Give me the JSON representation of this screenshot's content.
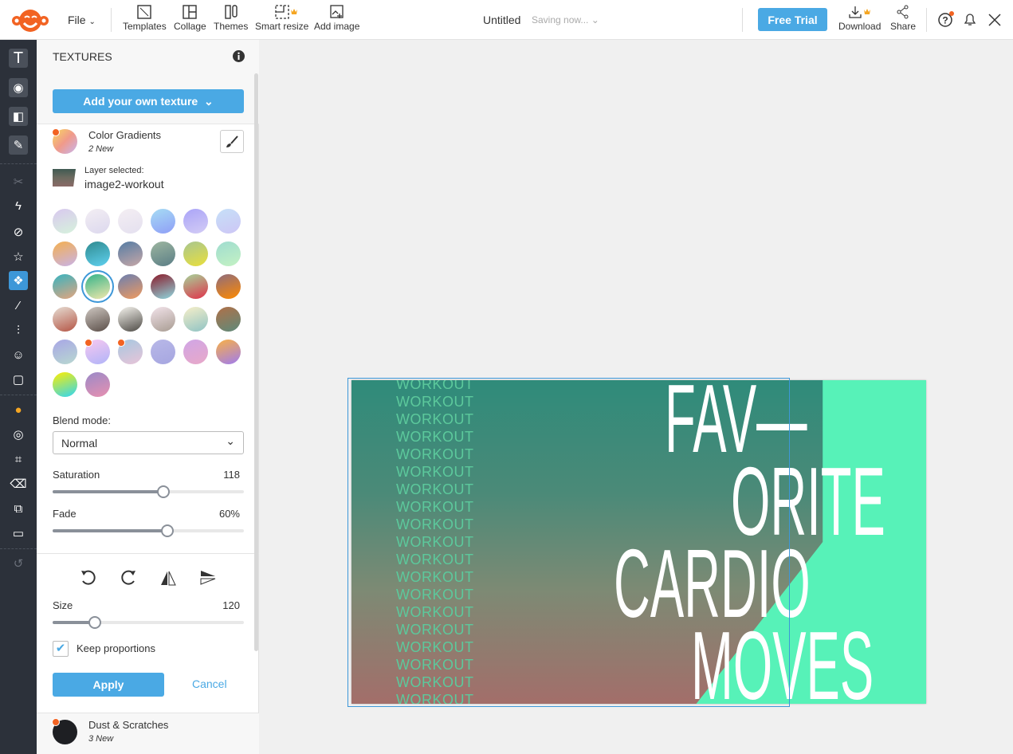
{
  "topbar": {
    "file": "File",
    "tools": [
      {
        "label": "Templates",
        "icon": "templates-icon"
      },
      {
        "label": "Collage",
        "icon": "collage-icon"
      },
      {
        "label": "Themes",
        "icon": "themes-icon"
      },
      {
        "label": "Smart resize",
        "icon": "smart-resize-icon",
        "premium": true
      },
      {
        "label": "Add image",
        "icon": "add-image-icon"
      }
    ],
    "title": "Untitled",
    "status": "Saving now...",
    "free_trial": "Free Trial",
    "download": "Download",
    "share": "Share"
  },
  "sidebar": {
    "icons": [
      "text-icon",
      "camera-icon",
      "shapes-icon",
      "draw-icon",
      "scissors-icon",
      "effects-icon",
      "overlay-icon",
      "stickers-icon",
      "textures-icon",
      "magic-wand-icon",
      "adjust-icon",
      "touch-up-icon",
      "frame-icon",
      "color-wheel-icon",
      "blend-icon",
      "crop-icon",
      "eraser-icon",
      "resize-icon",
      "comment-icon",
      "undo-icon"
    ],
    "active": "textures-icon"
  },
  "panel": {
    "title": "TEXTURES",
    "add_texture": "Add your own texture",
    "pack_name": "Color Gradients",
    "pack_new": "2 New",
    "layer_label": "Layer selected:",
    "layer_name": "image2-workout",
    "swatches": [
      [
        "#d9c8ef",
        "#d6f2dc"
      ],
      [
        "#f3eef3",
        "#dcd8ee"
      ],
      [
        "#f4eef3",
        "#e4e0ef"
      ],
      [
        "#a6dcf4",
        "#8f9ef7"
      ],
      [
        "#aaa4f8",
        "#d3ccf5"
      ],
      [
        "#c6e0f8",
        "#cdc6f5"
      ],
      [
        "#f4b04f",
        "#c8b2e8"
      ],
      [
        "#2f8a8f",
        "#5fd1f0"
      ],
      [
        "#557ca4",
        "#c7a7a7"
      ],
      [
        "#9db6a0",
        "#5b7e86"
      ],
      [
        "#a8c690",
        "#e9df3c"
      ],
      [
        "#9fdcd0",
        "#c4f2c3"
      ],
      [
        "#37b3bf",
        "#e4a57e"
      ],
      [
        "#33b389",
        "#f2e8ac"
      ],
      [
        "#6b7fb0",
        "#f09a5e"
      ],
      [
        "#8a1b2a",
        "#8fd8e0"
      ],
      [
        "#a6d49a",
        "#e0324a"
      ],
      [
        "#8e6c7e",
        "#ff8a00"
      ],
      [
        "#e6ddd3",
        "#b45545"
      ],
      [
        "#cfc8c2",
        "#5a4e48"
      ],
      [
        "#f6f4ee",
        "#4d4a45"
      ],
      [
        "#f2e3ea",
        "#a89c92"
      ],
      [
        "#f7efc9",
        "#8fc3c4"
      ],
      [
        "#b07048",
        "#5e8a7a"
      ],
      [
        "#a8a6e6",
        "#b8d8d0"
      ],
      [
        "#f8c8f0",
        "#b0b4f8"
      ],
      [
        "#a6c8e0",
        "#e8c4d8"
      ],
      [
        "#b8b8e8",
        "#a6a6e0"
      ],
      [
        "#d0a6e6",
        "#e8a8c8"
      ],
      [
        "#f9b045",
        "#9f7cf0"
      ],
      [
        "#ffee00",
        "#2dd6f6"
      ],
      [
        "#9a8ac8",
        "#e890b0"
      ]
    ],
    "selected_swatch": 13,
    "new_swatches": [
      0,
      25,
      26
    ],
    "blend_label": "Blend mode:",
    "blend_value": "Normal",
    "saturation_label": "Saturation",
    "saturation_value": "118",
    "saturation_fraction": 0.58,
    "fade_label": "Fade",
    "fade_value": "60%",
    "fade_fraction": 0.6,
    "transform_icons": [
      "rotate-left-icon",
      "rotate-right-icon",
      "flip-horizontal-icon",
      "flip-vertical-icon"
    ],
    "size_label": "Size",
    "size_value": "120",
    "size_fraction": 0.22,
    "keep_proportions": "Keep proportions",
    "keep_checked": true,
    "apply": "Apply",
    "cancel": "Cancel",
    "next_pack": "Dust & Scratches",
    "next_new": "3 New"
  },
  "canvas": {
    "repeat_text": "WORKOUT",
    "repeat_count": 19,
    "headline": [
      "FAV—",
      "ORITE",
      "CARDIO",
      "MOVES"
    ],
    "accent": "#57f2b8"
  },
  "colors": {
    "accent": "#4aa9e4",
    "sidebar": "#2c313a",
    "badge": "#f26322"
  }
}
